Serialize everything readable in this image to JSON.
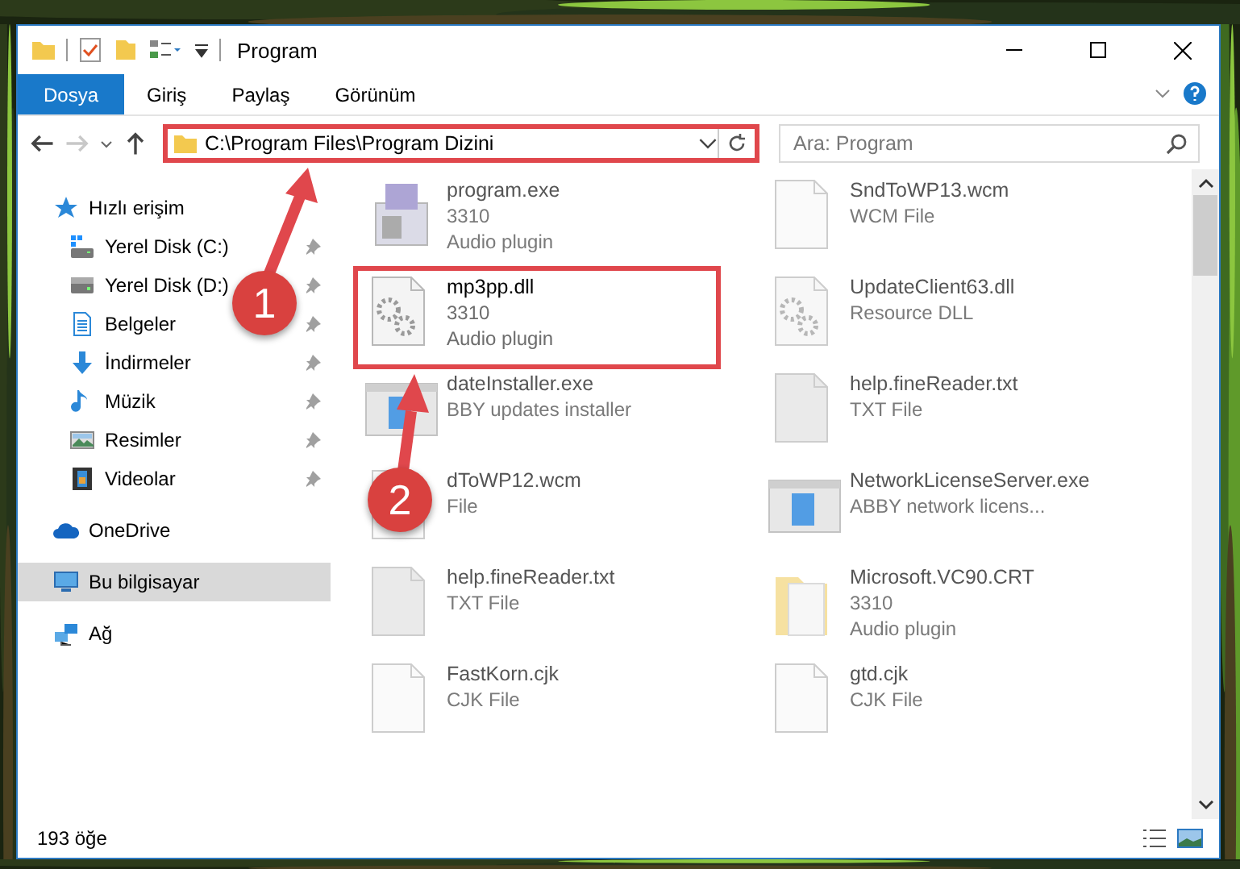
{
  "window": {
    "title": "Program"
  },
  "ribbon_tabs": [
    {
      "label": "Dosya",
      "selected": true
    },
    {
      "label": "Giriş",
      "selected": false
    },
    {
      "label": "Paylaş",
      "selected": false
    },
    {
      "label": "Görünüm",
      "selected": false
    }
  ],
  "address_bar": {
    "path": "C:\\Program Files\\Program Dizini",
    "highlighted": true
  },
  "search": {
    "placeholder": "Ara: Program"
  },
  "sidebar": {
    "items": [
      {
        "label": "Hızlı erişim",
        "kind": "star",
        "selected": false,
        "children": [
          {
            "label": "Yerel Disk (C:)",
            "kind": "system-drive",
            "pinned": true
          },
          {
            "label": "Yerel Disk (D:)",
            "kind": "drive",
            "pinned": true
          },
          {
            "label": "Belgeler",
            "kind": "document",
            "pinned": true
          },
          {
            "label": "İndirmeler",
            "kind": "download",
            "pinned": true
          },
          {
            "label": "Müzik",
            "kind": "music",
            "pinned": true
          },
          {
            "label": "Resimler",
            "kind": "pictures",
            "pinned": true
          },
          {
            "label": "Videolar",
            "kind": "film",
            "pinned": true
          }
        ]
      },
      {
        "label": "OneDrive",
        "kind": "cloud",
        "selected": false
      },
      {
        "label": "Bu bilgisayar",
        "kind": "computer",
        "selected": true
      },
      {
        "label": "Ağ",
        "kind": "network",
        "selected": false
      }
    ]
  },
  "files": [
    {
      "name": "program.exe",
      "details": [
        "3310",
        "Audio plugin"
      ],
      "kind": "program",
      "dimmed": true,
      "highlighted": false
    },
    {
      "name": "SndToWP13.wcm",
      "details": [
        "WCM File"
      ],
      "kind": "document",
      "dimmed": true,
      "highlighted": false
    },
    {
      "name": "mp3pp.dll",
      "details": [
        "3310",
        "Audio plugin"
      ],
      "kind": "library",
      "dimmed": false,
      "highlighted": true
    },
    {
      "name": "UpdateClient63.dll",
      "details": [
        "Resource DLL"
      ],
      "kind": "library",
      "dimmed": true,
      "highlighted": false
    },
    {
      "name": "dateInstaller.exe",
      "details": [
        "BBY updates installer"
      ],
      "kind": "window",
      "dimmed": true,
      "highlighted": false
    },
    {
      "name": "help.fineReader.txt",
      "details": [
        "TXT File"
      ],
      "kind": "text",
      "dimmed": true,
      "highlighted": false
    },
    {
      "name": "dToWP12.wcm",
      "details": [
        "File"
      ],
      "kind": "document",
      "dimmed": true,
      "highlighted": false
    },
    {
      "name": "NetworkLicenseServer.exe",
      "details": [
        "ABBY network licens..."
      ],
      "kind": "window",
      "dimmed": true,
      "highlighted": false
    },
    {
      "name": "help.fineReader.txt",
      "details": [
        "TXT File"
      ],
      "kind": "text",
      "dimmed": true,
      "highlighted": false
    },
    {
      "name": "Microsoft.VC90.CRT",
      "details": [
        "3310",
        "Audio plugin"
      ],
      "kind": "folder",
      "dimmed": true,
      "highlighted": false
    },
    {
      "name": "FastKorn.cjk",
      "details": [
        "CJK File"
      ],
      "kind": "document",
      "dimmed": true,
      "highlighted": false
    },
    {
      "name": "gtd.cjk",
      "details": [
        "CJK File"
      ],
      "kind": "document",
      "dimmed": true,
      "highlighted": false
    }
  ],
  "status_bar": {
    "count": "193 öğe"
  },
  "annotations": [
    {
      "label": "1"
    },
    {
      "label": "2"
    }
  ]
}
